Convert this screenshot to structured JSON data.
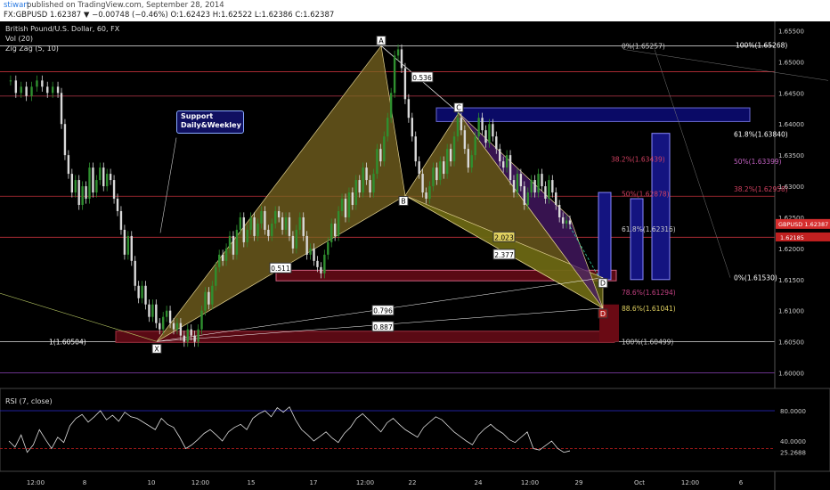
{
  "header": {
    "user": "stiwart",
    "published": "published on TradingView.com, September 28, 2014",
    "ohlc": "FX:GBPUSD 1.62387 ▼ −0.00748 (−0.46%) O:1.62423 H:1.62522 L:1.62386 C:1.62387"
  },
  "legend": {
    "title": "British Pound/U.S. Dollar, 60, FX",
    "vol": "Vol (20)",
    "zigzag": "Zig Zag (5, 10)"
  },
  "annotation": {
    "support_line1": "Support",
    "support_line2": "Daily&Weekley"
  },
  "rsi": {
    "label": "RSI (7, close)"
  },
  "colors": {
    "background": "#000000",
    "harmonic_fill": "#7a6520",
    "harmonic_fill2": "#6a6a10",
    "purple_fill": "#4a1a6a",
    "navy_box": "#0a0a66",
    "dark_red_box": "#5a0a14",
    "blue_box": "#141480",
    "candle_up": "#2f8f2f",
    "candle_down": "#d9d9d9",
    "price_tag": "#d62e2e"
  },
  "chart_data": {
    "type": "line",
    "title": "British Pound/U.S. Dollar, 60, FX",
    "price_axis_ticks": [
      "1.65500",
      "1.65000",
      "1.64500",
      "1.64000",
      "1.63500",
      "1.63000",
      "1.62500",
      "1.62000",
      "1.61500",
      "1.61000",
      "1.60500",
      "1.60000"
    ],
    "time_axis_ticks": [
      "12:00",
      "8",
      "10",
      "12:00",
      "15",
      "17",
      "12:00",
      "22",
      "24",
      "12:00",
      "29",
      "Oct",
      "12:00",
      "6"
    ],
    "ylim": [
      1.5975,
      1.6565
    ],
    "current_price_tag": "GBPUSD 1.62387",
    "price_tag_2": "1.62185",
    "price_path": [
      [
        0,
        1.647
      ],
      [
        0.6,
        1.647
      ],
      [
        1.2,
        1.645
      ],
      [
        1.8,
        1.646
      ],
      [
        2.4,
        1.6445
      ],
      [
        3,
        1.646
      ],
      [
        3.6,
        1.647
      ],
      [
        4.2,
        1.646
      ],
      [
        4.8,
        1.645
      ],
      [
        5.4,
        1.646
      ],
      [
        6,
        1.645
      ],
      [
        6.4,
        1.64
      ],
      [
        6.8,
        1.635
      ],
      [
        7.2,
        1.632
      ],
      [
        7.6,
        1.629
      ],
      [
        8,
        1.631
      ],
      [
        8.4,
        1.627
      ],
      [
        8.8,
        1.63
      ],
      [
        9.2,
        1.628
      ],
      [
        9.6,
        1.633
      ],
      [
        10,
        1.629
      ],
      [
        10.4,
        1.631
      ],
      [
        10.8,
        1.633
      ],
      [
        11.2,
        1.63
      ],
      [
        11.6,
        1.632
      ],
      [
        12,
        1.631
      ],
      [
        12.4,
        1.628
      ],
      [
        12.8,
        1.626
      ],
      [
        13.2,
        1.623
      ],
      [
        13.6,
        1.619
      ],
      [
        14,
        1.622
      ],
      [
        14.4,
        1.618
      ],
      [
        14.8,
        1.614
      ],
      [
        15.2,
        1.612
      ],
      [
        15.6,
        1.614
      ],
      [
        16,
        1.611
      ],
      [
        16.4,
        1.609
      ],
      [
        16.8,
        1.611
      ],
      [
        17.2,
        1.608
      ],
      [
        17.6,
        1.607
      ],
      [
        18,
        1.609
      ],
      [
        18.4,
        1.61
      ],
      [
        18.8,
        1.608
      ],
      [
        19.2,
        1.607
      ],
      [
        19.6,
        1.608
      ],
      [
        20,
        1.606
      ],
      [
        20.4,
        1.605
      ],
      [
        20.8,
        1.607
      ],
      [
        21.2,
        1.606
      ],
      [
        21.6,
        1.605
      ],
      [
        22,
        1.607
      ],
      [
        22.4,
        1.61
      ],
      [
        22.8,
        1.613
      ],
      [
        23.2,
        1.611
      ],
      [
        23.6,
        1.614
      ],
      [
        24,
        1.617
      ],
      [
        24.4,
        1.619
      ],
      [
        24.8,
        1.618
      ],
      [
        25.2,
        1.62
      ],
      [
        25.6,
        1.622
      ],
      [
        26,
        1.619
      ],
      [
        26.4,
        1.623
      ],
      [
        26.8,
        1.625
      ],
      [
        27.2,
        1.621
      ],
      [
        27.6,
        1.623
      ],
      [
        28,
        1.625
      ],
      [
        28.4,
        1.622
      ],
      [
        28.8,
        1.624
      ],
      [
        29.2,
        1.626
      ],
      [
        29.6,
        1.623
      ],
      [
        30,
        1.622
      ],
      [
        30.4,
        1.624
      ],
      [
        30.8,
        1.626
      ],
      [
        31.2,
        1.625
      ],
      [
        31.6,
        1.623
      ],
      [
        32,
        1.625
      ],
      [
        32.4,
        1.622
      ],
      [
        32.8,
        1.62
      ],
      [
        33.2,
        1.623
      ],
      [
        33.6,
        1.625
      ],
      [
        34,
        1.622
      ],
      [
        34.4,
        1.619
      ],
      [
        34.8,
        1.62
      ],
      [
        35.2,
        1.618
      ],
      [
        35.6,
        1.617
      ],
      [
        36,
        1.616
      ],
      [
        36.4,
        1.619
      ],
      [
        36.8,
        1.621
      ],
      [
        37.2,
        1.624
      ],
      [
        37.6,
        1.622
      ],
      [
        38,
        1.626
      ],
      [
        38.4,
        1.628
      ],
      [
        38.8,
        1.625
      ],
      [
        39.2,
        1.629
      ],
      [
        39.6,
        1.627
      ],
      [
        40,
        1.631
      ],
      [
        40.4,
        1.629
      ],
      [
        40.8,
        1.633
      ],
      [
        41.2,
        1.631
      ],
      [
        41.6,
        1.629
      ],
      [
        42,
        1.632
      ],
      [
        42.4,
        1.636
      ],
      [
        42.8,
        1.634
      ],
      [
        43.2,
        1.638
      ],
      [
        43.6,
        1.641
      ],
      [
        44,
        1.645
      ],
      [
        44.4,
        1.651
      ],
      [
        44.8,
        1.652
      ],
      [
        45.2,
        1.649
      ],
      [
        45.6,
        1.644
      ],
      [
        46,
        1.641
      ],
      [
        46.4,
        1.638
      ],
      [
        46.8,
        1.634
      ],
      [
        47.2,
        1.632
      ],
      [
        47.6,
        1.629
      ],
      [
        48,
        1.628
      ],
      [
        48.4,
        1.63
      ],
      [
        48.8,
        1.633
      ],
      [
        49.2,
        1.631
      ],
      [
        49.6,
        1.634
      ],
      [
        50,
        1.632
      ],
      [
        50.4,
        1.636
      ],
      [
        50.8,
        1.634
      ],
      [
        51.2,
        1.638
      ],
      [
        51.6,
        1.641
      ],
      [
        52,
        1.639
      ],
      [
        52.4,
        1.636
      ],
      [
        52.8,
        1.633
      ],
      [
        53.2,
        1.635
      ],
      [
        53.6,
        1.638
      ],
      [
        54,
        1.641
      ],
      [
        54.4,
        1.639
      ],
      [
        54.8,
        1.637
      ],
      [
        55.2,
        1.64
      ],
      [
        55.6,
        1.638
      ],
      [
        56,
        1.636
      ],
      [
        56.4,
        1.634
      ],
      [
        56.8,
        1.633
      ],
      [
        57.2,
        1.635
      ],
      [
        57.6,
        1.631
      ],
      [
        58,
        1.629
      ],
      [
        58.4,
        1.632
      ],
      [
        58.8,
        1.63
      ],
      [
        59.2,
        1.627
      ],
      [
        59.6,
        1.629
      ],
      [
        60,
        1.631
      ],
      [
        60.4,
        1.629
      ],
      [
        60.8,
        1.632
      ],
      [
        61.2,
        1.63
      ],
      [
        61.6,
        1.628
      ],
      [
        62,
        1.631
      ],
      [
        62.4,
        1.629
      ],
      [
        62.8,
        1.627
      ],
      [
        63.2,
        1.625
      ],
      [
        63.6,
        1.624
      ],
      [
        64,
        1.6245
      ],
      [
        64.4,
        1.6239
      ]
    ],
    "pattern_points": [
      {
        "label": "X",
        "price": 1.60504
      },
      {
        "label": "A",
        "price": 1.65257
      },
      {
        "label": "B",
        "price": 1.6285
      },
      {
        "label": "C",
        "price": 1.6418
      },
      {
        "label": "D",
        "price": 1.6153
      },
      {
        "label": "D",
        "price": 1.6104
      }
    ],
    "ratio_labels": [
      "0.536",
      "0.511",
      "0.796",
      "0.887",
      "2.023",
      "2.377"
    ],
    "fib_labels": [
      {
        "text": "0%(1.65257)",
        "price": 1.65257
      },
      {
        "text": "100%(1.65268)",
        "price": 1.65268
      },
      {
        "text": "61.8%(1.63840)",
        "price": 1.6384
      },
      {
        "text": "38.2%(1.63439)",
        "price": 1.63439
      },
      {
        "text": "50%(1.63399)",
        "price": 1.63399
      },
      {
        "text": "50%(1.62878)",
        "price": 1.62878
      },
      {
        "text": "38.2%(1.62958)",
        "price": 1.62958
      },
      {
        "text": "61.8%(1.62316)",
        "price": 1.62316
      },
      {
        "text": "0%(1.61530)",
        "price": 1.6153
      },
      {
        "text": "78.6%(1.61294)",
        "price": 1.61294
      },
      {
        "text": "88.6%(1.61041)",
        "price": 1.61041
      },
      {
        "text": "100%(1.60499)",
        "price": 1.60499
      },
      {
        "text": "1(1.60504)",
        "price": 1.60504
      }
    ],
    "rsi_axis_ticks": [
      "80.0000",
      "40.0000",
      "25.2688"
    ],
    "rsi_values": [
      40,
      32,
      48,
      25,
      35,
      55,
      42,
      30,
      45,
      38,
      60,
      70,
      75,
      65,
      72,
      80,
      68,
      74,
      66,
      78,
      72,
      70,
      65,
      60,
      55,
      70,
      62,
      58,
      45,
      30,
      35,
      42,
      50,
      55,
      48,
      40,
      52,
      58,
      62,
      55,
      70,
      76,
      80,
      72,
      84,
      78,
      85,
      68,
      55,
      48,
      40,
      46,
      52,
      44,
      38,
      50,
      58,
      70,
      76,
      68,
      60,
      52,
      64,
      70,
      62,
      55,
      50,
      45,
      58,
      65,
      72,
      68,
      60,
      52,
      46,
      40,
      35,
      48,
      56,
      62,
      55,
      50,
      42,
      38,
      45,
      52,
      30,
      28,
      34,
      40,
      30,
      25,
      27
    ]
  }
}
